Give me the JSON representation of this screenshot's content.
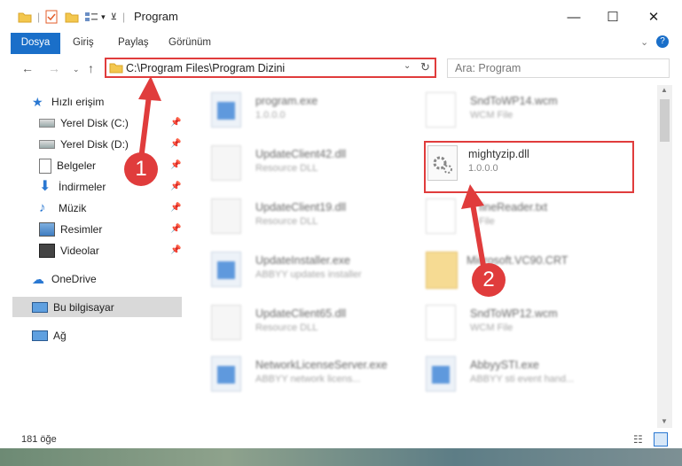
{
  "window": {
    "title": "Program",
    "minimize": "—",
    "maximize": "☐",
    "close": "✕"
  },
  "ribbon": {
    "tabs": [
      "Dosya",
      "Giriş",
      "Paylaş",
      "Görünüm"
    ]
  },
  "address": {
    "path": "C:\\Program Files\\Program Dizini",
    "search_placeholder": "Ara: Program"
  },
  "sidebar": {
    "quick_access": "Hızlı erişim",
    "items": [
      "Yerel Disk (C:)",
      "Yerel Disk (D:)",
      "Belgeler",
      "İndirmeler",
      "Müzik",
      "Resimler",
      "Videolar"
    ],
    "onedrive": "OneDrive",
    "this_pc": "Bu bilgisayar",
    "network": "Ağ"
  },
  "files": [
    {
      "name": "program.exe",
      "sub": "1.0.0.0"
    },
    {
      "name": "SndToWP14.wcm",
      "sub": "WCM File"
    },
    {
      "name": "UpdateClient42.dll",
      "sub": "Resource DLL"
    },
    {
      "name": "mightyzip.dll",
      "sub": "1.0.0.0"
    },
    {
      "name": "UpdateClient19.dll",
      "sub": "Resource DLL"
    },
    {
      "name": "fineReader.txt",
      "sub": "File"
    },
    {
      "name": "UpdateInstaller.exe",
      "sub": "ABBYY updates installer"
    },
    {
      "name": "Microsoft.VC90.CRT",
      "sub": ""
    },
    {
      "name": "UpdateClient65.dll",
      "sub": "Resource DLL"
    },
    {
      "name": "SndToWP12.wcm",
      "sub": "WCM File"
    },
    {
      "name": "NetworkLicenseServer.exe",
      "sub": "ABBYY network licens..."
    },
    {
      "name": "AbbyySTI.exe",
      "sub": "ABBYY sti event hand..."
    }
  ],
  "status": {
    "count": "181 öğe"
  },
  "annotations": {
    "step1": "1",
    "step2": "2"
  },
  "colors": {
    "accent": "#1a6fc9",
    "highlight": "#e03c3c"
  }
}
